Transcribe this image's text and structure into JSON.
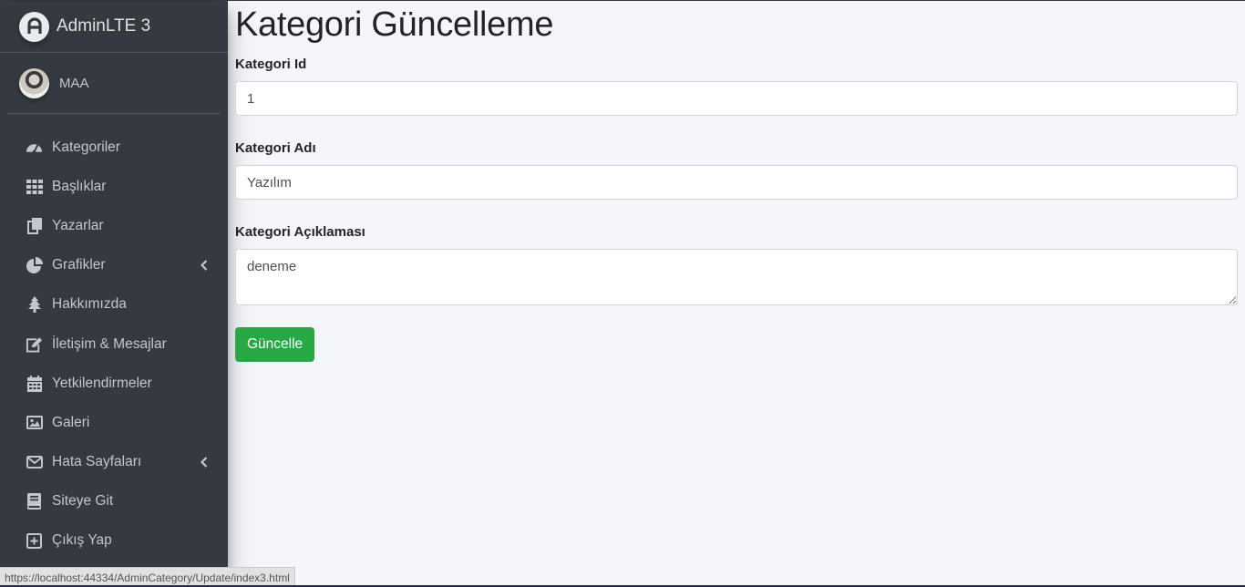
{
  "brand": {
    "name": "AdminLTE 3"
  },
  "user": {
    "name": "MAA"
  },
  "nav": [
    {
      "label": "Kategoriler",
      "icon": "gauge-icon"
    },
    {
      "label": "Başlıklar",
      "icon": "grid-icon"
    },
    {
      "label": "Yazarlar",
      "icon": "copy-icon"
    },
    {
      "label": "Grafikler",
      "icon": "pie-chart-icon",
      "expandable": true
    },
    {
      "label": "Hakkımızda",
      "icon": "tree-icon"
    },
    {
      "label": "İletişim & Mesajlar",
      "icon": "edit-icon"
    },
    {
      "label": "Yetkilendirmeler",
      "icon": "calendar-icon"
    },
    {
      "label": "Galeri",
      "icon": "image-icon"
    },
    {
      "label": "Hata Sayfaları",
      "icon": "envelope-icon",
      "expandable": true
    },
    {
      "label": "Siteye Git",
      "icon": "book-icon"
    },
    {
      "label": "Çıkış Yap",
      "icon": "plus-square-icon"
    }
  ],
  "page": {
    "title": "Kategori Güncelleme"
  },
  "form": {
    "id_label": "Kategori Id",
    "id_value": "1",
    "name_label": "Kategori Adı",
    "name_value": "Yazılım",
    "desc_label": "Kategori Açıklaması",
    "desc_value": "deneme",
    "submit_label": "Güncelle"
  },
  "status": {
    "url": "https://localhost:44334/AdminCategory/Update/index3.html"
  },
  "colors": {
    "sidebar": "#343a40",
    "accent": "#28a745",
    "background": "#f4f6f9"
  }
}
